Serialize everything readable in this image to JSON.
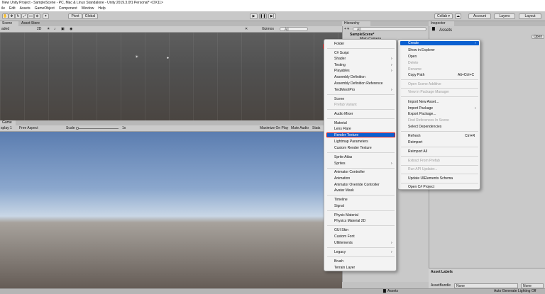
{
  "window": {
    "title": "New Unity Project - SampleScene - PC, Mac & Linux Standalone - Unity 2019.3.0f1 Personal* <DX11>"
  },
  "menubar": [
    "ile",
    "Edit",
    "Assets",
    "GameObject",
    "Component",
    "Window",
    "Help"
  ],
  "toolbar": {
    "pivot": "Pivot",
    "global": "Global",
    "collab": "Collab ▾",
    "account": "Account",
    "layers": "Layers",
    "layout": "Layout"
  },
  "scene": {
    "tab_scene": "Scene",
    "tab_asset_store": "Asset Store",
    "shading": "aded",
    "mode_2d": "2D",
    "gizmos": "Gizmos",
    "search": "All"
  },
  "game": {
    "tab_game": "Game",
    "display": "splay 1",
    "aspect": "Free Aspect",
    "scale_label": "Scale",
    "scale_value": "1x",
    "maximize": "Maximize On Play",
    "mute": "Mute Audio",
    "stats": "Stats"
  },
  "hierarchy": {
    "tab": "Hierarchy",
    "add": "+ ▾",
    "search": "All",
    "scene_name": "SampleScene*",
    "item": "Main Camera"
  },
  "inspector": {
    "tab": "Inspector",
    "folder": "Assets",
    "open": "Open"
  },
  "asset_labels": {
    "title": "Asset Labels",
    "bundle_label": "AssetBundle",
    "bundle_value": "None",
    "variant_value": "None"
  },
  "status": {
    "assets": "Assets",
    "lighting": "Auto Generate Lighting Off"
  },
  "menu_main": {
    "items": [
      {
        "label": "Create",
        "shortcut": "",
        "submenu": true,
        "highlight": true,
        "disabled": false
      },
      {
        "label": "Show in Explorer",
        "shortcut": "",
        "submenu": false,
        "disabled": false
      },
      {
        "label": "Open",
        "shortcut": "",
        "submenu": false,
        "disabled": false
      },
      {
        "label": "Delete",
        "shortcut": "",
        "submenu": false,
        "disabled": true
      },
      {
        "label": "Rename",
        "shortcut": "",
        "submenu": false,
        "disabled": true
      },
      {
        "label": "Copy Path",
        "shortcut": "Alt+Ctrl+C",
        "submenu": false,
        "disabled": false
      },
      {
        "label": "Open Scene Additive",
        "shortcut": "",
        "submenu": false,
        "disabled": true
      },
      {
        "label": "View in Package Manager",
        "shortcut": "",
        "submenu": false,
        "disabled": true
      },
      {
        "label": "Import New Asset...",
        "shortcut": "",
        "submenu": false,
        "disabled": false
      },
      {
        "label": "Import Package",
        "shortcut": "",
        "submenu": true,
        "disabled": false
      },
      {
        "label": "Export Package...",
        "shortcut": "",
        "submenu": false,
        "disabled": false
      },
      {
        "label": "Find References In Scene",
        "shortcut": "",
        "submenu": false,
        "disabled": true
      },
      {
        "label": "Select Dependencies",
        "shortcut": "",
        "submenu": false,
        "disabled": false
      },
      {
        "label": "Refresh",
        "shortcut": "Ctrl+R",
        "submenu": false,
        "disabled": false
      },
      {
        "label": "Reimport",
        "shortcut": "",
        "submenu": false,
        "disabled": false
      },
      {
        "label": "Reimport All",
        "shortcut": "",
        "submenu": false,
        "disabled": false
      },
      {
        "label": "Extract From Prefab",
        "shortcut": "",
        "submenu": false,
        "disabled": true
      },
      {
        "label": "Run API Updater...",
        "shortcut": "",
        "submenu": false,
        "disabled": true
      },
      {
        "label": "Update UIElements Schema",
        "shortcut": "",
        "submenu": false,
        "disabled": false
      },
      {
        "label": "Open C# Project",
        "shortcut": "",
        "submenu": false,
        "disabled": false
      }
    ]
  },
  "menu_create": {
    "items": [
      {
        "label": "Folder",
        "submenu": false,
        "disabled": false
      },
      {
        "label": "C# Script",
        "submenu": false,
        "disabled": false
      },
      {
        "label": "Shader",
        "submenu": true,
        "disabled": false
      },
      {
        "label": "Testing",
        "submenu": true,
        "disabled": false
      },
      {
        "label": "Playables",
        "submenu": true,
        "disabled": false
      },
      {
        "label": "Assembly Definition",
        "submenu": false,
        "disabled": false
      },
      {
        "label": "Assembly Definition Reference",
        "submenu": false,
        "disabled": false
      },
      {
        "label": "TextMeshPro",
        "submenu": true,
        "disabled": false
      },
      {
        "label": "Scene",
        "submenu": false,
        "disabled": false
      },
      {
        "label": "Prefab Variant",
        "submenu": false,
        "disabled": true
      },
      {
        "label": "Audio Mixer",
        "submenu": false,
        "disabled": false
      },
      {
        "label": "Material",
        "submenu": false,
        "disabled": false
      },
      {
        "label": "Lens Flare",
        "submenu": false,
        "disabled": false
      },
      {
        "label": "Render Texture",
        "submenu": false,
        "disabled": false,
        "highlight": true
      },
      {
        "label": "Lightmap Parameters",
        "submenu": false,
        "disabled": false
      },
      {
        "label": "Custom Render Texture",
        "submenu": false,
        "disabled": false
      },
      {
        "label": "Sprite Atlas",
        "submenu": false,
        "disabled": false
      },
      {
        "label": "Sprites",
        "submenu": true,
        "disabled": false
      },
      {
        "label": "Animator Controller",
        "submenu": false,
        "disabled": false
      },
      {
        "label": "Animation",
        "submenu": false,
        "disabled": false
      },
      {
        "label": "Animator Override Controller",
        "submenu": false,
        "disabled": false
      },
      {
        "label": "Avatar Mask",
        "submenu": false,
        "disabled": false
      },
      {
        "label": "Timeline",
        "submenu": false,
        "disabled": false
      },
      {
        "label": "Signal",
        "submenu": false,
        "disabled": false
      },
      {
        "label": "Physic Material",
        "submenu": false,
        "disabled": false
      },
      {
        "label": "Physics Material 2D",
        "submenu": false,
        "disabled": false
      },
      {
        "label": "GUI Skin",
        "submenu": false,
        "disabled": false
      },
      {
        "label": "Custom Font",
        "submenu": false,
        "disabled": false
      },
      {
        "label": "UIElements",
        "submenu": true,
        "disabled": false
      },
      {
        "label": "Legacy",
        "submenu": true,
        "disabled": false
      },
      {
        "label": "Brush",
        "submenu": false,
        "disabled": false
      },
      {
        "label": "Terrain Layer",
        "submenu": false,
        "disabled": false
      }
    ]
  },
  "colors": {
    "menu_highlight": "#0a5fd0",
    "selection_outline": "#e01010"
  }
}
